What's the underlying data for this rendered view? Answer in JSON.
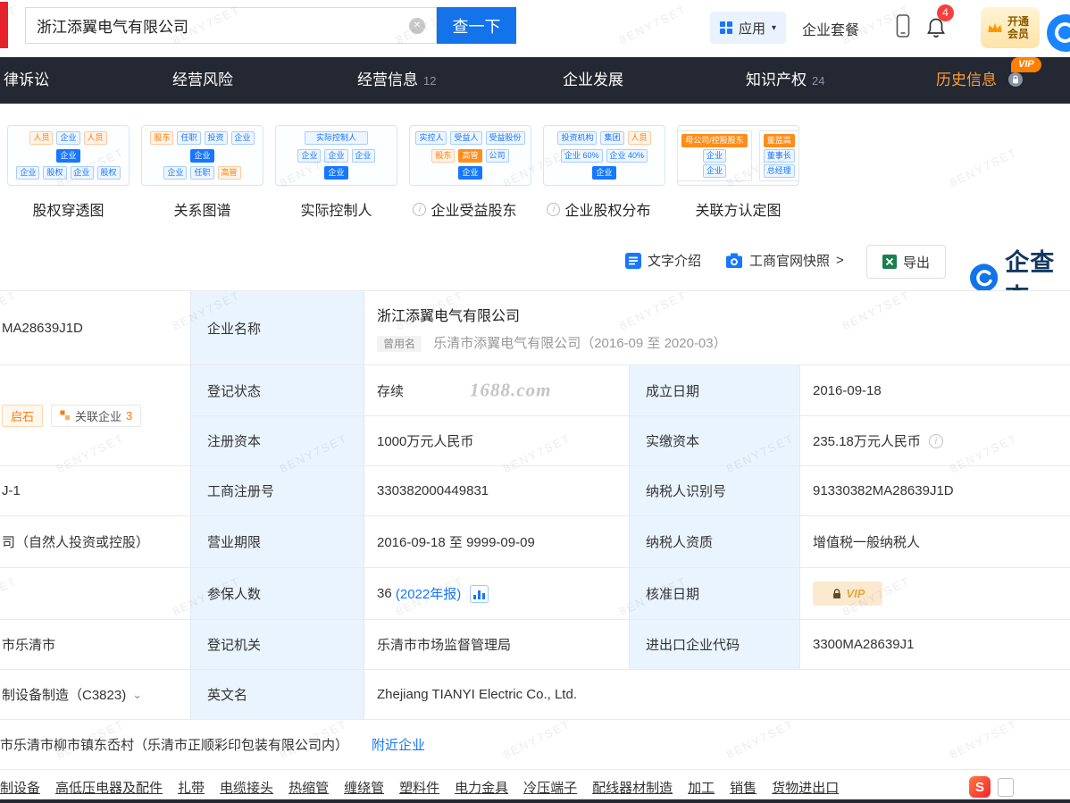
{
  "watermark": {
    "text": "8ENY7SET"
  },
  "icons": {
    "clear": "✕",
    "caret": "▾",
    "info": "i",
    "chevron_down": "⌄"
  },
  "topbar": {
    "search_value": "浙江添翼电气有限公司",
    "search_button": "查一下",
    "apps_label": "应用",
    "package_label": "企业套餐",
    "notification_count": "4",
    "vip_line1": "开通",
    "vip_line2": "会员"
  },
  "nav": {
    "items": [
      {
        "label": "律诉讼"
      },
      {
        "label": "经营风险"
      },
      {
        "label": "经营信息",
        "count": "12"
      },
      {
        "label": "企业发展"
      },
      {
        "label": "知识产权",
        "count": "24"
      },
      {
        "label": "历史信息",
        "vip_tag": "VIP"
      }
    ]
  },
  "charts": {
    "cards": [
      {
        "title": "股权穿透图",
        "chips": {
          "r1": [
            "人员",
            "企业",
            "人员"
          ],
          "r2": [
            "企业"
          ],
          "r3": [
            "企业",
            "股权",
            "企业",
            "股权"
          ]
        }
      },
      {
        "title": "关系图谱",
        "chips": {
          "r1": [
            "股东",
            "任职",
            "投资",
            "企业"
          ],
          "r2": [
            "企业"
          ],
          "r3": [
            "企业",
            "任职",
            "高管"
          ]
        }
      },
      {
        "title": "实际控制人",
        "chips": {
          "r1": [
            "实际控制人"
          ],
          "r2": [
            "企业",
            "企业",
            "企业"
          ],
          "r3": [
            "企业"
          ]
        }
      },
      {
        "title": "企业受益股东",
        "info": true,
        "chips": {
          "r1": [
            "实控人",
            "受益人",
            "受益股份"
          ],
          "r2": [
            "股东",
            "高管",
            "公司"
          ],
          "r3": [
            "企业"
          ]
        }
      },
      {
        "title": "企业股权分布",
        "info": true,
        "chips": {
          "r1": [
            "投资机构",
            "集团",
            "人员"
          ],
          "r2": [
            "企业 60%",
            "企业 40%"
          ],
          "r3": [
            "企业"
          ]
        }
      },
      {
        "title": "关联方认定图",
        "groups": [
          {
            "header": "母公司/控股股东",
            "items": [
              "企业",
              "企业"
            ]
          },
          {
            "header": "董监高",
            "items": [
              "董事长",
              "总经理"
            ]
          }
        ]
      }
    ]
  },
  "actions": {
    "text_intro": "文字介绍",
    "snapshot": "工商官网快照",
    "snapshot_chevron": ">",
    "export": "导出",
    "brand": "企查查"
  },
  "table": {
    "left": {
      "credit_code": "MA28639J1D",
      "tag_qishi": "启石",
      "tag_related": "关联企业",
      "tag_related_count": "3",
      "org_code": "J-1",
      "company_type": "司（自然人投资或控股）",
      "region": "市乐清市",
      "industry": "制设备制造（C3823)"
    },
    "rows": {
      "name": {
        "label": "企业名称",
        "value": "浙江添翼电气有限公司",
        "former_tag": "曾用名",
        "former_value": "乐清市添翼电气有限公司（2016-09 至 2020-03）"
      },
      "status": {
        "label": "登记状态",
        "value": "存续",
        "watermark": "1688.com",
        "label2": "成立日期",
        "value2": "2016-09-18"
      },
      "capital": {
        "label": "注册资本",
        "value": "1000万元人民币",
        "label2": "实缴资本",
        "value2": "235.18万元人民币"
      },
      "regno": {
        "label": "工商注册号",
        "value": "330382000449831",
        "label2": "纳税人识别号",
        "value2": "91330382MA28639J1D"
      },
      "term": {
        "label": "营业期限",
        "value": "2016-09-18 至 9999-09-09",
        "label2": "纳税人资质",
        "value2": "增值税一般纳税人"
      },
      "insured": {
        "label": "参保人数",
        "value": "36",
        "report_link": "(2022年报)",
        "label2": "核准日期",
        "vip_text": "VIP"
      },
      "authority": {
        "label": "登记机关",
        "value": "乐清市市场监督管理局",
        "label2": "进出口企业代码",
        "value2": "3300MA28639J1"
      },
      "english": {
        "label": "英文名",
        "value": "Zhejiang TIANYI Electric Co., Ltd."
      },
      "address": {
        "value": "市乐清市柳市镇东岙村（乐清市正顺彩印包装有限公司内）",
        "link": "附近企业"
      }
    },
    "scope_keywords": [
      "制设备",
      "高低压电器及配件",
      "扎带",
      "电缆接头",
      "热缩管",
      "缠绕管",
      "塑料件",
      "电力金具",
      "冷压端子",
      "配线器材制造",
      "加工",
      "销售",
      "货物进出口"
    ]
  },
  "colors": {
    "accent_blue": "#1373EB",
    "nav_bg": "#232833",
    "label_bg": "#E9F4FF",
    "vip_orange": "#FF8000"
  }
}
